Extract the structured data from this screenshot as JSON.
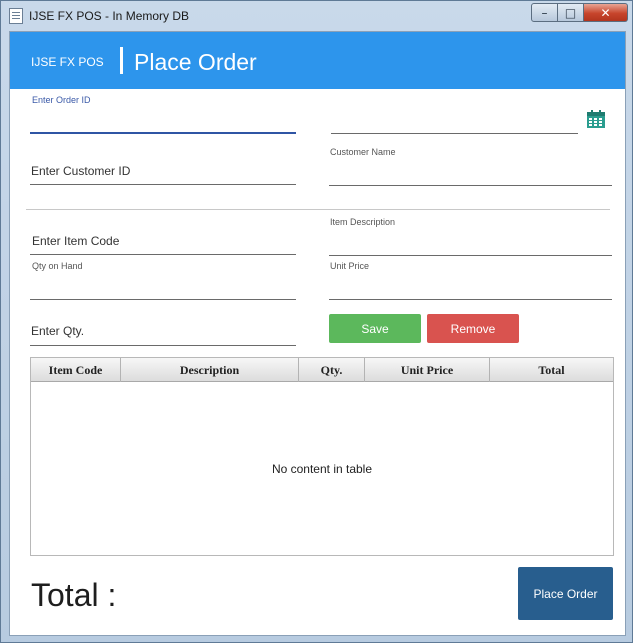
{
  "window": {
    "title": "IJSE FX POS - In Memory DB",
    "controls": {
      "minimize": "–",
      "maximize": "□",
      "close": "✕"
    }
  },
  "header": {
    "brand": "IJSE FX POS",
    "page_title": "Place Order",
    "color": "#2d95ec"
  },
  "form": {
    "order_id_label": "Enter Order ID",
    "order_id_value": "",
    "date_value": "",
    "customer_id_prompt": "Enter Customer ID",
    "customer_name_label": "Customer Name",
    "customer_name_value": "",
    "item_code_prompt": "Enter Item Code",
    "item_description_label": "Item Description",
    "qty_on_hand_label": "Qty on Hand",
    "unit_price_label": "Unit Price",
    "qty_prompt": "Enter Qty."
  },
  "buttons": {
    "save": "Save",
    "remove": "Remove",
    "place_order": "Place Order"
  },
  "table": {
    "columns": [
      "Item Code",
      "Description",
      "Qty.",
      "Unit Price",
      "Total"
    ],
    "rows": [],
    "empty_message": "No content in table"
  },
  "footer": {
    "total_label": "Total :"
  },
  "icons": {
    "calendar": "calendar-icon"
  },
  "colors": {
    "save": "#5cb85c",
    "remove": "#d9534f",
    "place_order": "#285e8e"
  }
}
